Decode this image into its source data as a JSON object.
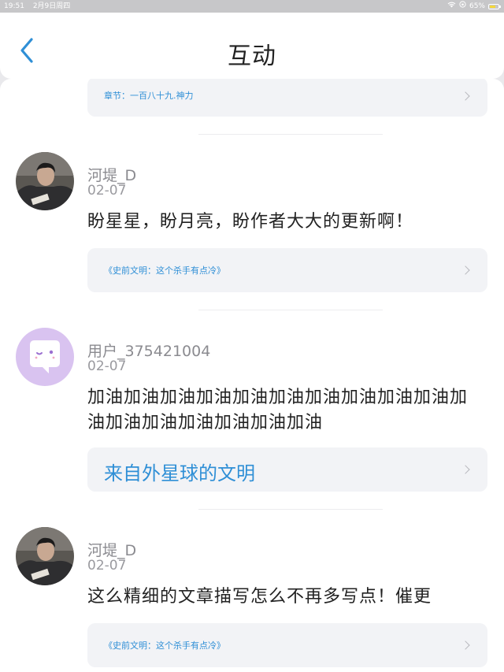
{
  "status_bar": {
    "time": "19:51",
    "date": "2月9日周四",
    "battery": "65%"
  },
  "header": {
    "title": "互动"
  },
  "feed": {
    "first_source": "章节：一百八十九.神力",
    "items": [
      {
        "username": "河堤_D",
        "date": "02-07",
        "comment": "盼星星，盼月亮，盼作者大大的更新啊！",
        "source": "《史前文明：这个杀手有点冷》"
      },
      {
        "username": "用户_375421004",
        "date": "02-07",
        "comment": "加油加油加油加油加油加油加油加油加油加油加油加油加油加油加油加油加油",
        "source": "来自外星球的文明"
      },
      {
        "username": "河堤_D",
        "date": "02-07",
        "comment": "这么精细的文章描写怎么不再多写点！催更",
        "source": "《史前文明：这个杀手有点冷》"
      }
    ]
  },
  "colors": {
    "accent": "#2f8fd6",
    "avatar_default_bg": "#d9c3f0"
  }
}
